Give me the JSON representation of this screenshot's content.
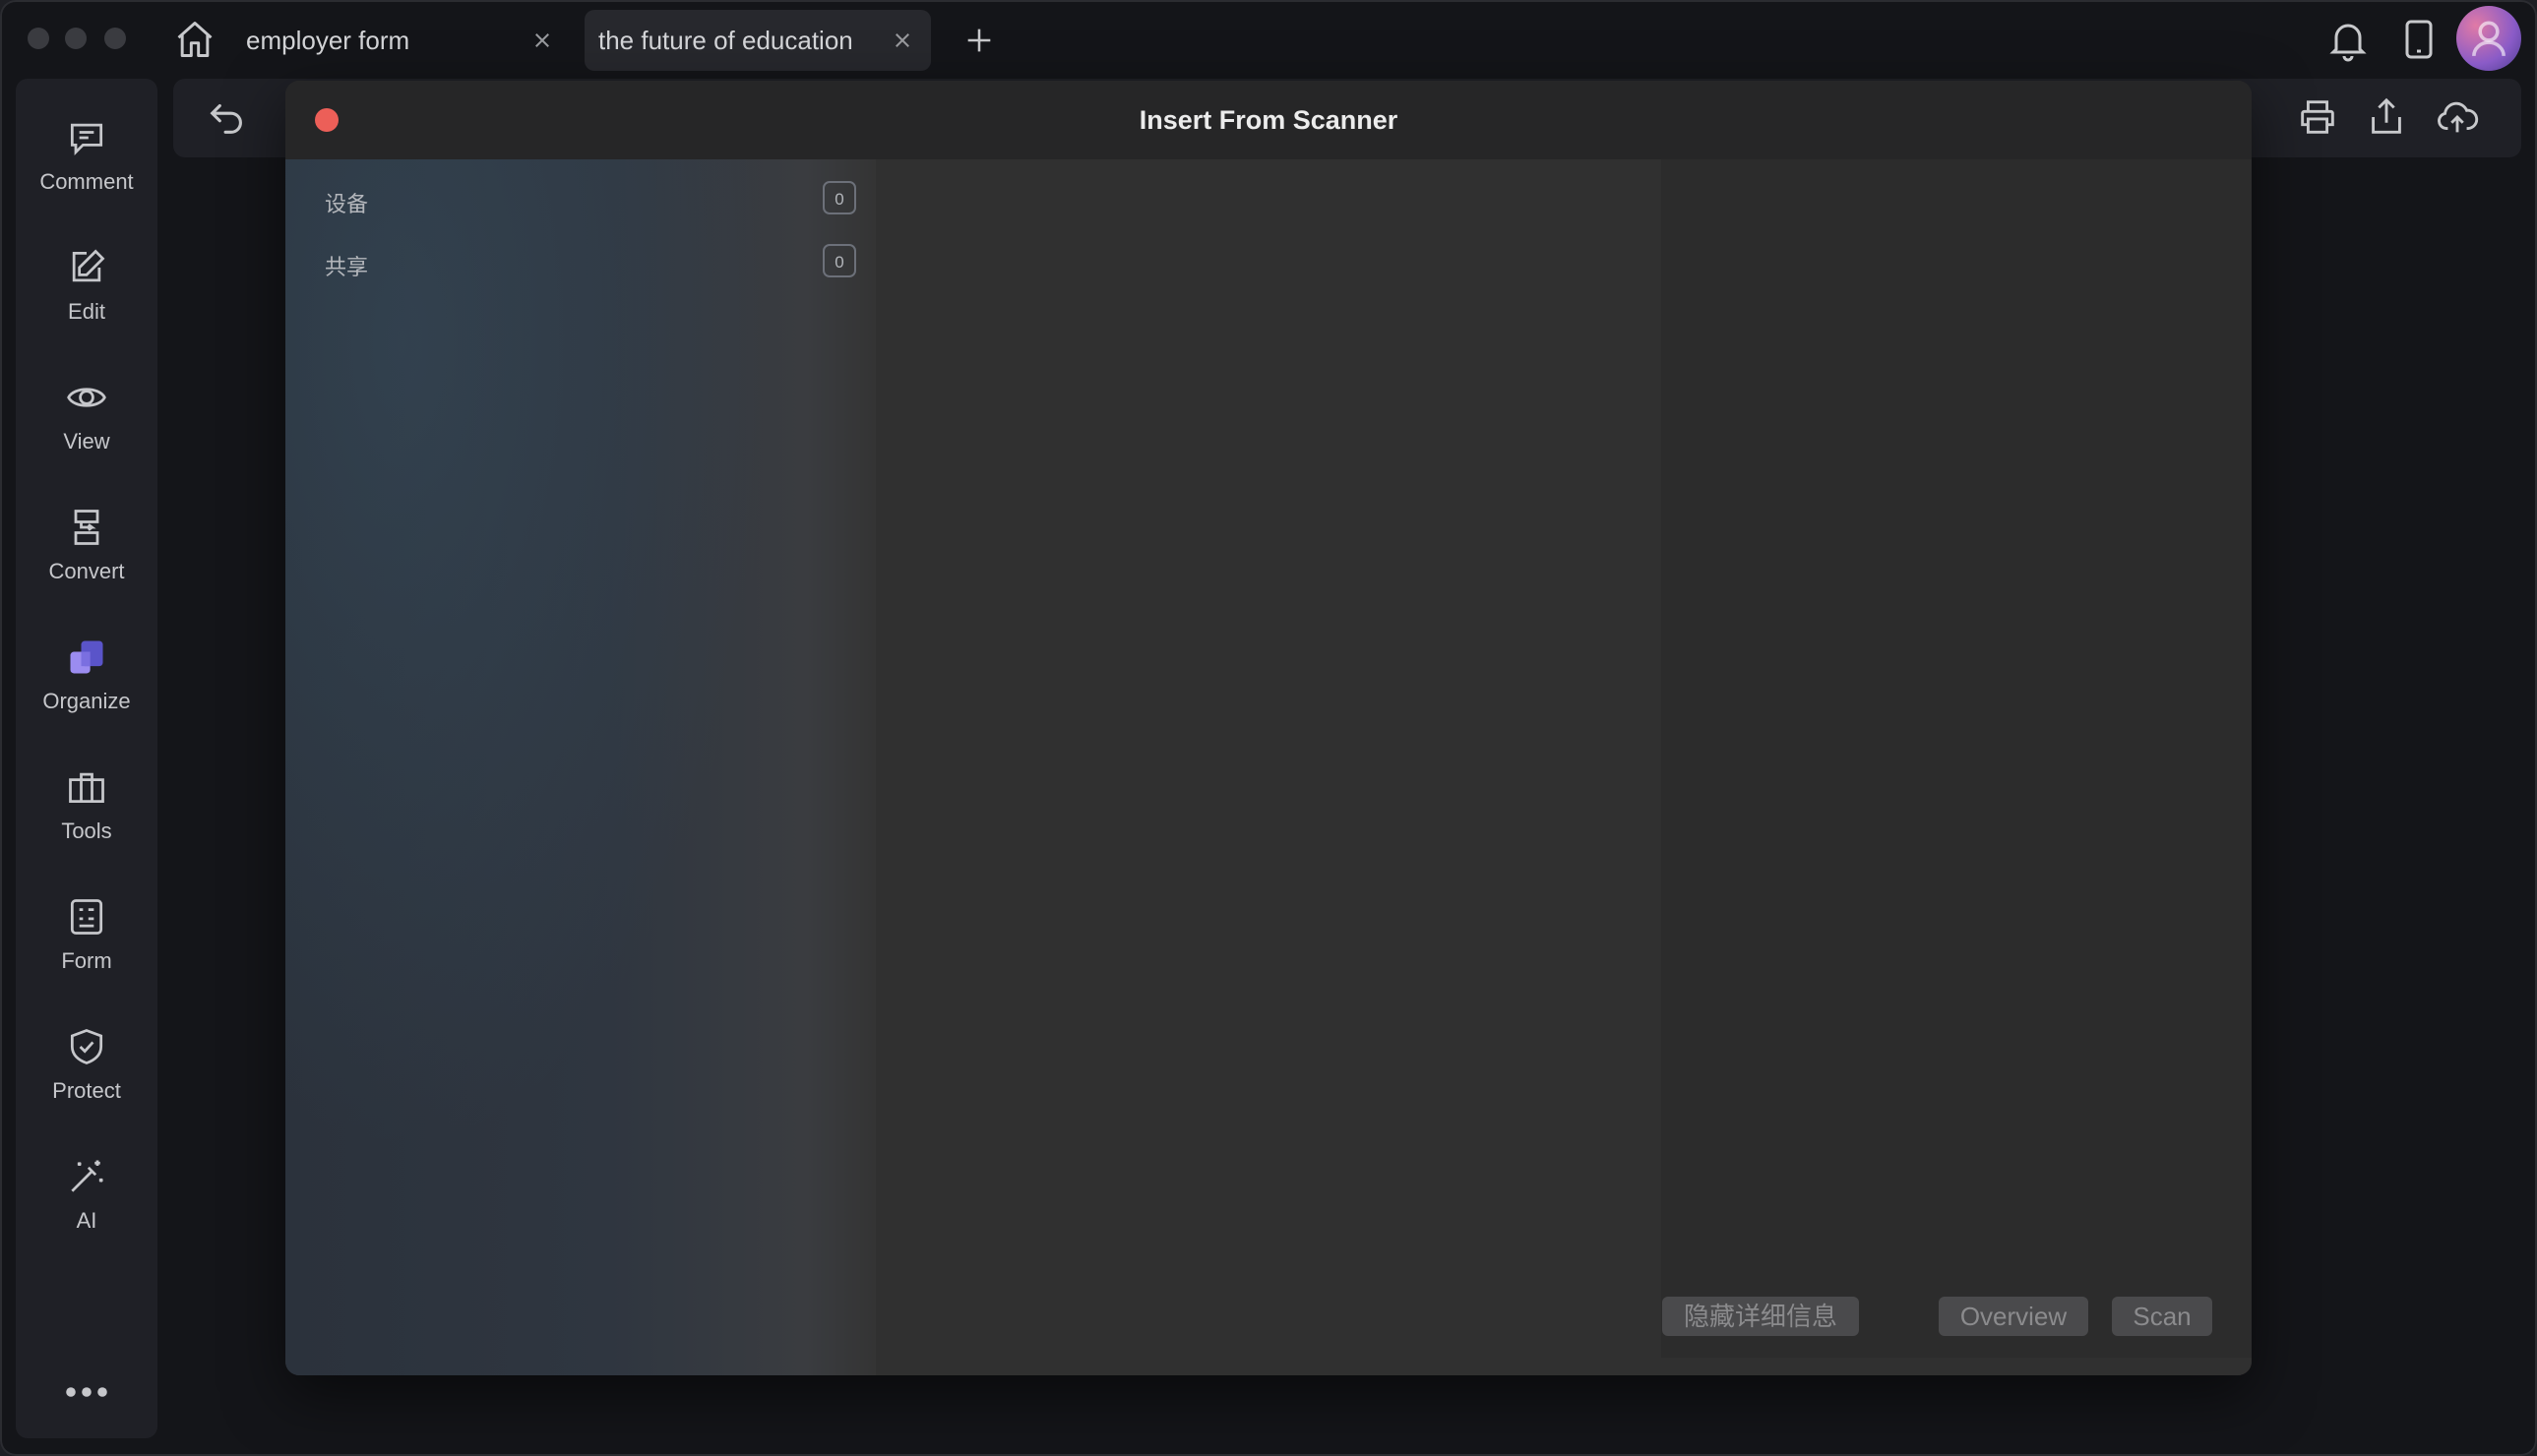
{
  "tabs": [
    {
      "label": "employer form",
      "active": false
    },
    {
      "label": "the future of education",
      "active": true
    }
  ],
  "sidebar": {
    "items": [
      {
        "label": "Comment",
        "icon": "comment-icon"
      },
      {
        "label": "Edit",
        "icon": "edit-icon"
      },
      {
        "label": "View",
        "icon": "eye-icon"
      },
      {
        "label": "Convert",
        "icon": "convert-icon"
      },
      {
        "label": "Organize",
        "icon": "organize-icon"
      },
      {
        "label": "Tools",
        "icon": "toolbox-icon"
      },
      {
        "label": "Form",
        "icon": "form-icon"
      },
      {
        "label": "Protect",
        "icon": "shield-icon"
      },
      {
        "label": "AI",
        "icon": "magic-wand-icon"
      }
    ]
  },
  "dialog": {
    "title": "Insert From Scanner",
    "sources": [
      {
        "label": "设备",
        "count": "0"
      },
      {
        "label": "共享",
        "count": "0"
      }
    ],
    "buttons": {
      "hide_details": "隐藏详细信息",
      "overview": "Overview",
      "scan": "Scan"
    }
  },
  "colors": {
    "close_red": "#ec5f58",
    "background": "#141519",
    "dialog_bg": "#2e2e2f"
  }
}
